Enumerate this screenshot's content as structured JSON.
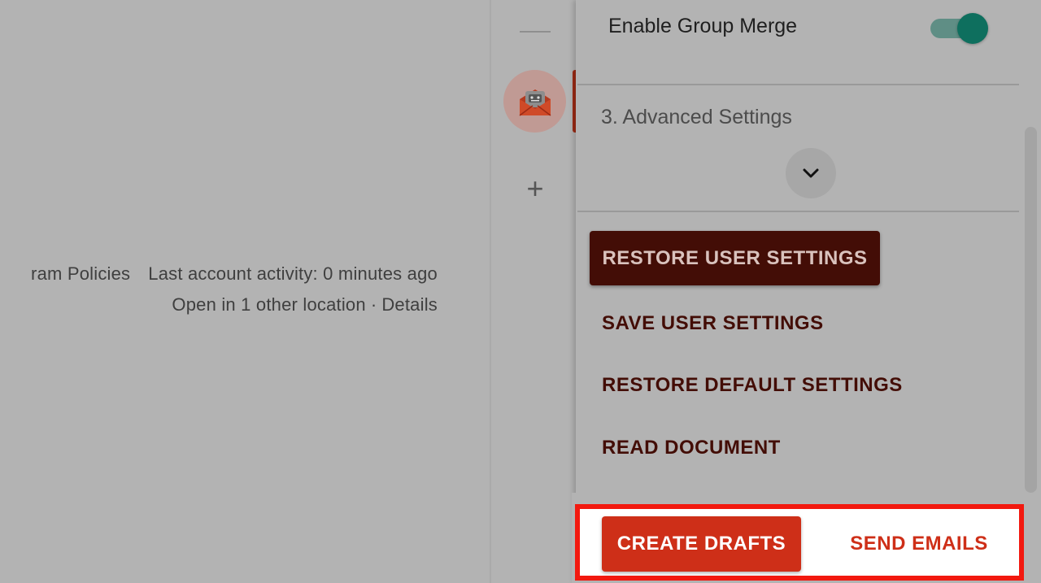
{
  "footer": {
    "program_policies": "ram Policies",
    "last_activity": "Last account activity: 0 minutes ago",
    "open_locations": "Open in 1 other location",
    "separator": "·",
    "details_link": "Details"
  },
  "side_strip": {
    "addon_icon": "envelope-robot-icon",
    "add_icon": "plus-icon",
    "add_label": "+"
  },
  "panel": {
    "toggle_label": "Enable Group Merge",
    "toggle_on": true,
    "section_title": "3. Advanced Settings",
    "expand_icon": "chevron-down-icon",
    "buttons": {
      "restore_user_settings": "RESTORE USER SETTINGS",
      "save_user_settings": "SAVE USER SETTINGS",
      "restore_default_settings": "RESTORE DEFAULT SETTINGS",
      "read_document": "READ DOCUMENT"
    }
  },
  "actions": {
    "create_drafts": "CREATE DRAFTS",
    "send_emails": "SEND EMAILS"
  },
  "colors": {
    "accent": "#ce2f18",
    "dark_button": "#430d06",
    "toggle_on": "#0e6f5e",
    "highlight": "#f2190f"
  }
}
